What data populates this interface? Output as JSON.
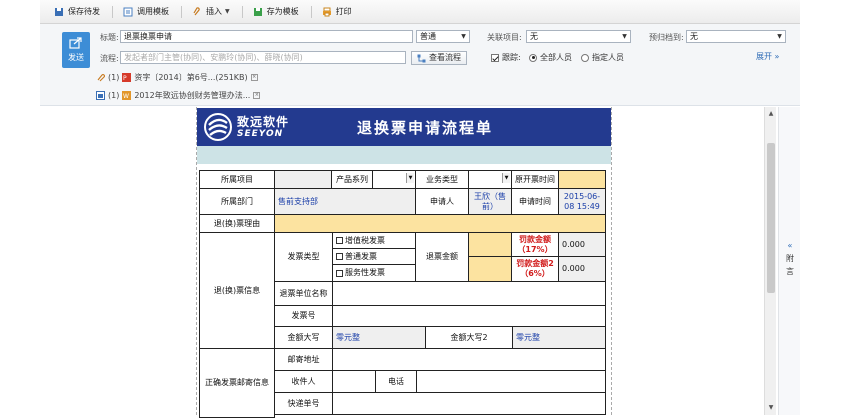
{
  "toolbar": {
    "buttons": [
      "保存待发",
      "调用模板",
      "插入",
      "存为模板",
      "打印"
    ]
  },
  "header": {
    "send_label": "发送",
    "title_label": "标题:",
    "title_value": "退票换票申请",
    "priority_value": "普通",
    "related_label": "关联项目:",
    "related_value": "无",
    "archive_label": "预归档到:",
    "archive_value": "无",
    "flow_label": "流程:",
    "flow_placeholder": "发起者部门主管(协同)、安鹏玲(协同)、薛晓(协同)",
    "view_flow_label": "查看流程",
    "track_label": "跟踪:",
    "all_people_label": "全部人员",
    "specific_people_label": "指定人员",
    "expand_label": "展开",
    "attachments": [
      {
        "count": "(1)",
        "name": "资字〔2014〕第6号...(251KB)"
      },
      {
        "count": "(1)",
        "name": "2012年致远协创财务管理办法..."
      }
    ]
  },
  "form": {
    "logo_cn": "致远软件",
    "logo_en": "SEEYON",
    "title": "退换票申请流程单",
    "labels": {
      "project": "所属项目",
      "product_series": "产品系列",
      "business_type": "业务类型",
      "original_time": "原开票时间",
      "department": "所属部门",
      "department_value": "售前支持部",
      "applicant": "申请人",
      "applicant_value": "王欣（售前）",
      "apply_time": "申请时间",
      "apply_time_value": "2015-06-08 15:49",
      "reason": "退(换)票理由",
      "ticket_info": "退(换)票信息",
      "ticket_type": "发票类型",
      "vat": "增值税发票",
      "normal": "普通发票",
      "service": "服务性发票",
      "ticket_amount": "退票金额",
      "penalty1": "罚款金额（17%）",
      "penalty1_value": "0.000",
      "penalty2": "罚款金额2（6%）",
      "penalty2_value": "0.000",
      "unit_name": "退票单位名称",
      "ticket_no": "发票号",
      "amount_upper": "金额大写",
      "amount_upper_value": "零元整",
      "amount_upper2": "金额大写2",
      "amount_upper2_value": "零元整",
      "mail_info": "正确发票邮寄信息",
      "mail_address": "邮寄地址",
      "receiver": "收件人",
      "phone": "电话",
      "express_no": "快递单号"
    }
  },
  "sidepanel": {
    "tab_label": "附言"
  }
}
